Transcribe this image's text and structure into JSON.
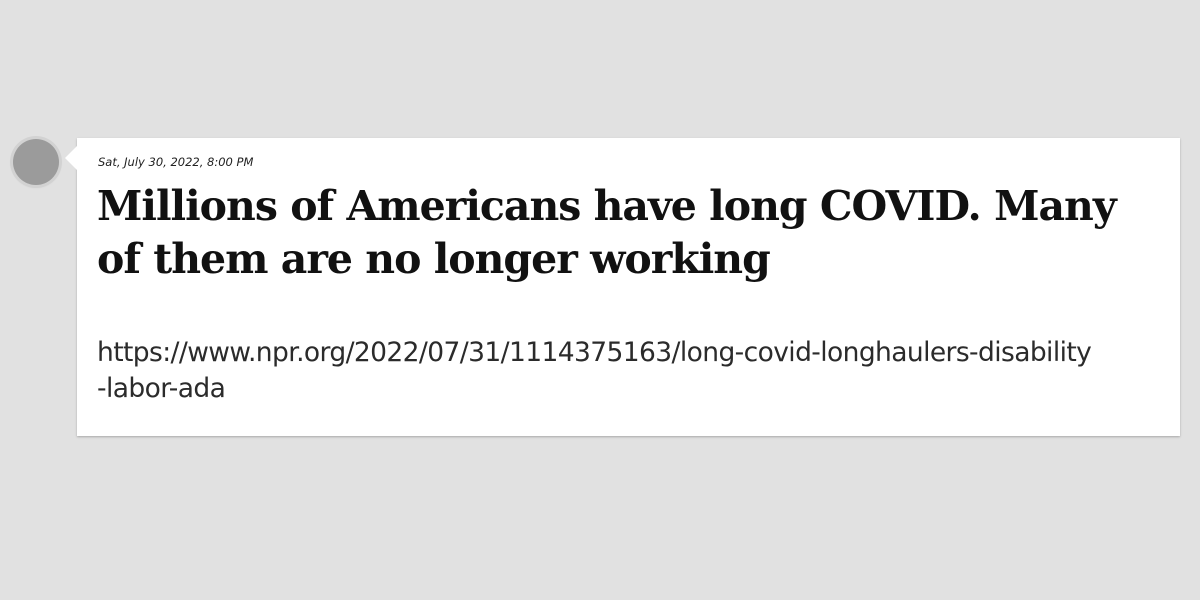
{
  "post": {
    "timestamp": "Sat, July 30, 2022, 8:00 PM",
    "headline": "Millions of Americans have long COVID. Many of them are no longer working",
    "url": "https://www.npr.org/2022/07/31/1114375163/long-covid-longhaulers-disability-labor-ada"
  },
  "colors": {
    "background": "#e1e1e1",
    "card": "#ffffff",
    "dot": "#9b9b9b"
  }
}
